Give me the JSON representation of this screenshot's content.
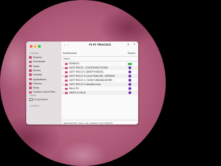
{
  "window": {
    "title": "Fi-Fi TRACKS",
    "nav": "‹ ›",
    "more": "»",
    "add": "+",
    "tab_left": "bandforward",
    "tab_right": "Search",
    "column_header": "Name",
    "path": "Macintosh HD › Users › feli › Desktop › Fi-Fi TRACKS"
  },
  "sidebar": {
    "favorites_label": "Favorites",
    "favorites": [
      {
        "label": "Dropbox",
        "icon": "dropbox-icon"
      },
      {
        "label": "Downloads",
        "icon": "downloads-icon"
      },
      {
        "label": "Splice",
        "icon": "splice-icon"
      },
      {
        "label": "Movies",
        "icon": "movies-icon"
      },
      {
        "label": "Desktop",
        "icon": "desktop-icon"
      },
      {
        "label": "Applications",
        "icon": "applications-icon"
      },
      {
        "label": "Pictures",
        "icon": "pictures-icon"
      },
      {
        "label": "Music",
        "icon": "music-icon"
      },
      {
        "label": "Creative Cloud Files",
        "icon": "creative-cloud-icon"
      }
    ],
    "icloud_label": "iCloud",
    "icloud": [
      {
        "label": "iCloud Drive",
        "icon": "icloud-drive-icon"
      }
    ],
    "locations_label": "Locations"
  },
  "files": [
    {
      "name": "SENEKO",
      "tag_color": "#37b34a",
      "tag_shape": "g"
    },
    {
      "name": "JUST ROCO - CONTRADICTIONS",
      "tag_color": "#6a2fb0",
      "tag_shape": "dot"
    },
    {
      "name": "JUST ROCO 2 (DEEP INSIDE)",
      "tag_color": "#6a2fb0",
      "tag_shape": "dot"
    },
    {
      "name": "JUST ROCO 3 LA ULTIMA DEL VERANO",
      "tag_color": "#6a2fb0",
      "tag_shape": "dot"
    },
    {
      "name": "JUST ROCO 1 I DONT WANNA WORK",
      "tag_color": "#6a2fb0",
      "tag_shape": "dot"
    },
    {
      "name": "JUST ROCO 2 demdem loco",
      "tag_color": "#6a2fb0",
      "tag_shape": "dot"
    },
    {
      "name": "PALLITO",
      "tag_color": "#6a2fb0",
      "tag_shape": "dot"
    },
    {
      "name": "VAMO A LIALA",
      "tag_color": "#6a2fb0",
      "tag_shape": "dot"
    }
  ],
  "colors": {
    "accent": "#d04f7a",
    "close": "#ff5f57",
    "minimize": "#febc2e",
    "zoom": "#28c840"
  }
}
